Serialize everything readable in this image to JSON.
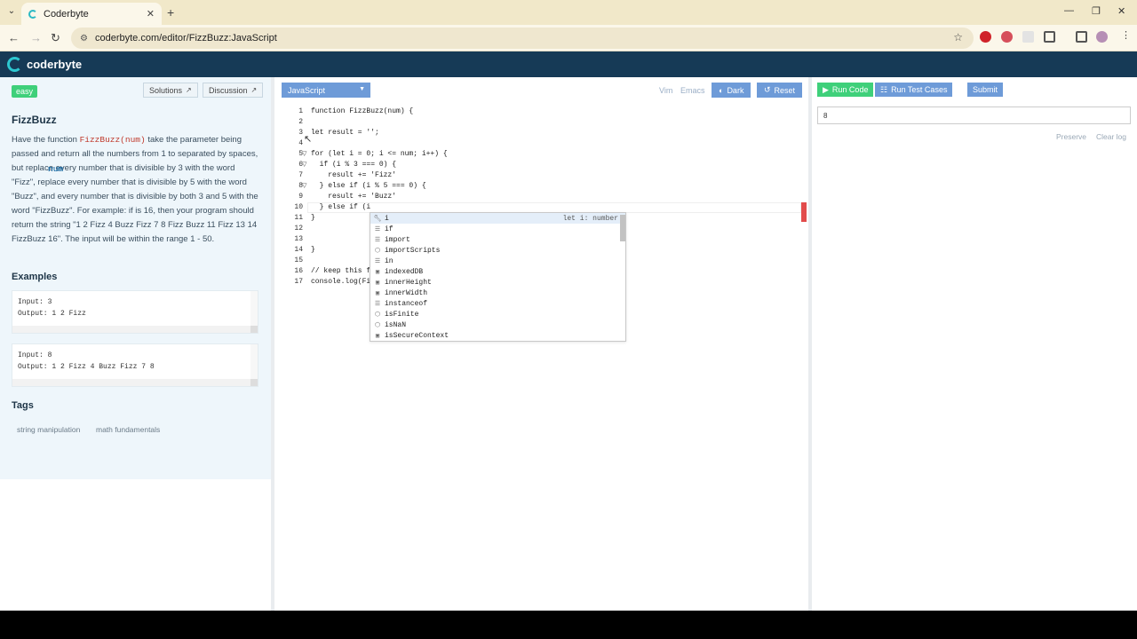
{
  "browser": {
    "tab_title": "Coderbyte",
    "url": "coderbyte.com/editor/FizzBuzz:JavaScript"
  },
  "header": {
    "brand": "coderbyte"
  },
  "problem": {
    "difficulty": "easy",
    "solutions_label": "Solutions",
    "discussion_label": "Discussion",
    "title": "FizzBuzz",
    "desc": {
      "p1": "Have the function ",
      "fn": "FizzBuzz(num)",
      "p2": " take the ",
      "num1": "num",
      "p3": " parameter being passed and return all the numbers from 1 to ",
      "num2": "num",
      "p4": " separated by spaces, but replace every number that is divisible by 3 with the word \"Fizz\", replace every number that is divisible by 5 with the word \"Buzz\", and every number that is divisible by both 3 and 5 with the word \"FizzBuzz\". For example: if ",
      "num3": "num",
      "p5": " is 16, then your program should return the string \"1 2 Fizz 4 Buzz Fizz 7 8 Fizz Buzz 11 Fizz 13 14 FizzBuzz 16\". The input will be within the range 1 - 50."
    },
    "examples_heading": "Examples",
    "examples": [
      {
        "input": "Input: 3",
        "output": "Output: 1 2 Fizz"
      },
      {
        "input": "Input: 8",
        "output": "Output: 1 2 Fizz 4 Buzz Fizz 7 8"
      }
    ],
    "tags_heading": "Tags",
    "tags": [
      "string manipulation",
      "math fundamentals"
    ]
  },
  "editor": {
    "language": "JavaScript",
    "vim_label": "Vim",
    "emacs_label": "Emacs",
    "dark_label": "Dark",
    "reset_label": "Reset",
    "line_numbers": [
      "1",
      "2",
      "3",
      "4",
      "5",
      "6",
      "7",
      "8",
      "9",
      "10",
      "11",
      "12",
      "13",
      "14",
      "15",
      "16",
      "17"
    ],
    "lines": [
      "function FizzBuzz(num) {",
      "",
      "let result = '';",
      "",
      "for (let i = 0; i <= num; i++) {",
      "  if (i % 3 === 0) {",
      "    result += 'Fizz'",
      "  } else if (i % 5 === 0) {",
      "    result += 'Buzz'",
      "  } else if (i",
      "}",
      "",
      "",
      "}",
      "",
      "// keep this f",
      "console.log(Fi"
    ]
  },
  "autocomplete": {
    "items": [
      {
        "icon": "wrench",
        "label": "i",
        "detail": "let i: number"
      },
      {
        "icon": "keyword",
        "label": "if",
        "detail": ""
      },
      {
        "icon": "keyword",
        "label": "import",
        "detail": ""
      },
      {
        "icon": "module",
        "label": "importScripts",
        "detail": ""
      },
      {
        "icon": "keyword",
        "label": "in",
        "detail": ""
      },
      {
        "icon": "variable",
        "label": "indexedDB",
        "detail": ""
      },
      {
        "icon": "variable",
        "label": "innerHeight",
        "detail": ""
      },
      {
        "icon": "variable",
        "label": "innerWidth",
        "detail": ""
      },
      {
        "icon": "keyword",
        "label": "instanceof",
        "detail": ""
      },
      {
        "icon": "module",
        "label": "isFinite",
        "detail": ""
      },
      {
        "icon": "module",
        "label": "isNaN",
        "detail": ""
      },
      {
        "icon": "variable",
        "label": "isSecureContext",
        "detail": ""
      }
    ]
  },
  "console": {
    "run_code_label": "Run Code",
    "run_tests_label": "Run Test Cases",
    "submit_label": "Submit",
    "input_value": "8",
    "preserve_label": "Preserve",
    "clear_log_label": "Clear log"
  },
  "colors": {
    "header_bg": "#163a56",
    "accent_blue": "#6e9bd8",
    "run_green": "#3fd07a",
    "easy_green": "#3fd07a"
  }
}
